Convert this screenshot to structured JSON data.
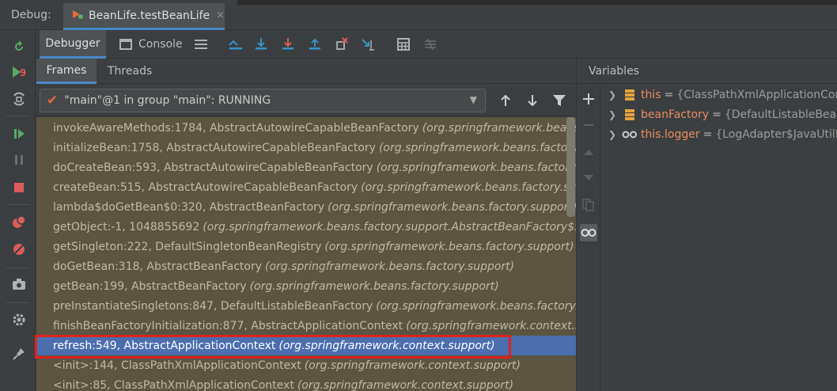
{
  "topbar": {
    "debug_label": "Debug:",
    "session_tab": "BeanLife.testBeanLife",
    "close_glyph": "×"
  },
  "toolbar": {
    "debugger_tab": "Debugger",
    "console_tab": "Console"
  },
  "frames_pane": {
    "frames_tab": "Frames",
    "threads_tab": "Threads",
    "thread_selector": "\"main\"@1 in group \"main\": RUNNING",
    "frames": [
      {
        "method": "invokeAwareMethods:1784, AbstractAutowireCapableBeanFactory",
        "package": "(org.springframework.beans.factory.support)"
      },
      {
        "method": "initializeBean:1758, AbstractAutowireCapableBeanFactory",
        "package": "(org.springframework.beans.factory.support)"
      },
      {
        "method": "doCreateBean:593, AbstractAutowireCapableBeanFactory",
        "package": "(org.springframework.beans.factory.support)"
      },
      {
        "method": "createBean:515, AbstractAutowireCapableBeanFactory",
        "package": "(org.springframework.beans.factory.support)"
      },
      {
        "method": "lambda$doGetBean$0:320, AbstractBeanFactory",
        "package": "(org.springframework.beans.factory.support)"
      },
      {
        "method": "getObject:-1, 1048855692",
        "package": "(org.springframework.beans.factory.support.AbstractBeanFactory$$Lambda)"
      },
      {
        "method": "getSingleton:222, DefaultSingletonBeanRegistry",
        "package": "(org.springframework.beans.factory.support)"
      },
      {
        "method": "doGetBean:318, AbstractBeanFactory",
        "package": "(org.springframework.beans.factory.support)"
      },
      {
        "method": "getBean:199, AbstractBeanFactory",
        "package": "(org.springframework.beans.factory.support)"
      },
      {
        "method": "preInstantiateSingletons:847, DefaultListableBeanFactory",
        "package": "(org.springframework.beans.factory.support)"
      },
      {
        "method": "finishBeanFactoryInitialization:877, AbstractApplicationContext",
        "package": "(org.springframework.context.support)"
      },
      {
        "method": "refresh:549, AbstractApplicationContext",
        "package": "(org.springframework.context.support)"
      },
      {
        "method": "<init>:144, ClassPathXmlApplicationContext",
        "package": "(org.springframework.context.support)"
      },
      {
        "method": "<init>:85, ClassPathXmlApplicationContext",
        "package": "(org.springframework.context.support)"
      }
    ]
  },
  "variables_pane": {
    "title": "Variables",
    "variables": [
      {
        "name": "this",
        "value": "{ClassPathXmlApplicationContext@...}"
      },
      {
        "name": "beanFactory",
        "value": "{DefaultListableBeanFactory@...}"
      },
      {
        "name": "this.logger",
        "value": "{LogAdapter$JavaUtilLog@...}"
      }
    ]
  },
  "colors": {
    "frame_bg": "#5b5541",
    "selected_frame": "#4b6eaf",
    "highlight_box": "#e0211e",
    "accent": "#4a88c7"
  }
}
